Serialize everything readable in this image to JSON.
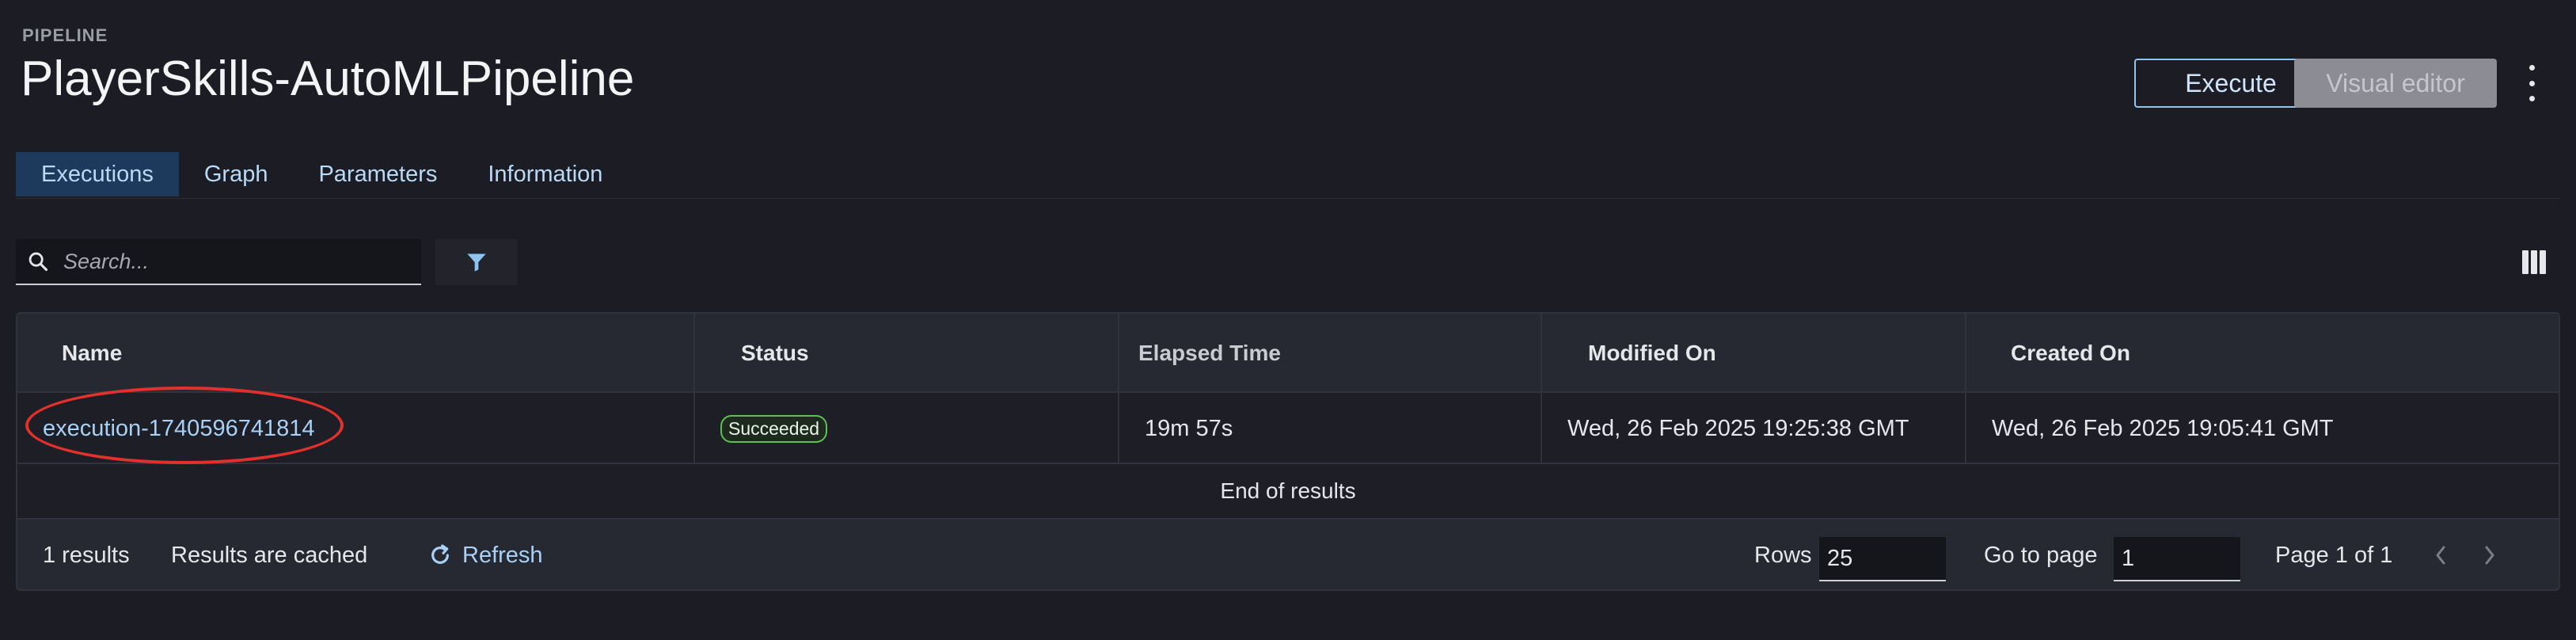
{
  "header": {
    "eyebrow": "PIPELINE",
    "title": "PlayerSkills-AutoMLPipeline",
    "execute_label": "Execute",
    "visual_editor_label": "Visual editor"
  },
  "tabs": [
    {
      "label": "Executions",
      "active": true
    },
    {
      "label": "Graph",
      "active": false
    },
    {
      "label": "Parameters",
      "active": false
    },
    {
      "label": "Information",
      "active": false
    }
  ],
  "toolbar": {
    "search_placeholder": "Search..."
  },
  "table": {
    "columns": [
      "Name",
      "Status",
      "Elapsed Time",
      "Modified On",
      "Created On"
    ],
    "rows": [
      {
        "name": "execution-1740596741814",
        "status": "Succeeded",
        "elapsed": "19m 57s",
        "modified": "Wed, 26 Feb 2025 19:25:38 GMT",
        "created": "Wed, 26 Feb 2025 19:05:41 GMT"
      }
    ],
    "end_text": "End of results"
  },
  "footer": {
    "results_count": "1 results",
    "cache_note": "Results are cached",
    "refresh_label": "Refresh",
    "rows_label": "Rows",
    "rows_value": "25",
    "goto_label": "Go to page",
    "goto_value": "1",
    "page_status": "Page 1 of 1"
  },
  "colors": {
    "background": "#1b1c24",
    "accent_link": "#a8d1f5",
    "success": "#5fbf53",
    "annotation": "#e0312c"
  },
  "icons": [
    "more-vertical-icon",
    "search-icon",
    "filter-icon",
    "columns-icon",
    "refresh-icon",
    "chevron-left-icon",
    "chevron-right-icon"
  ]
}
